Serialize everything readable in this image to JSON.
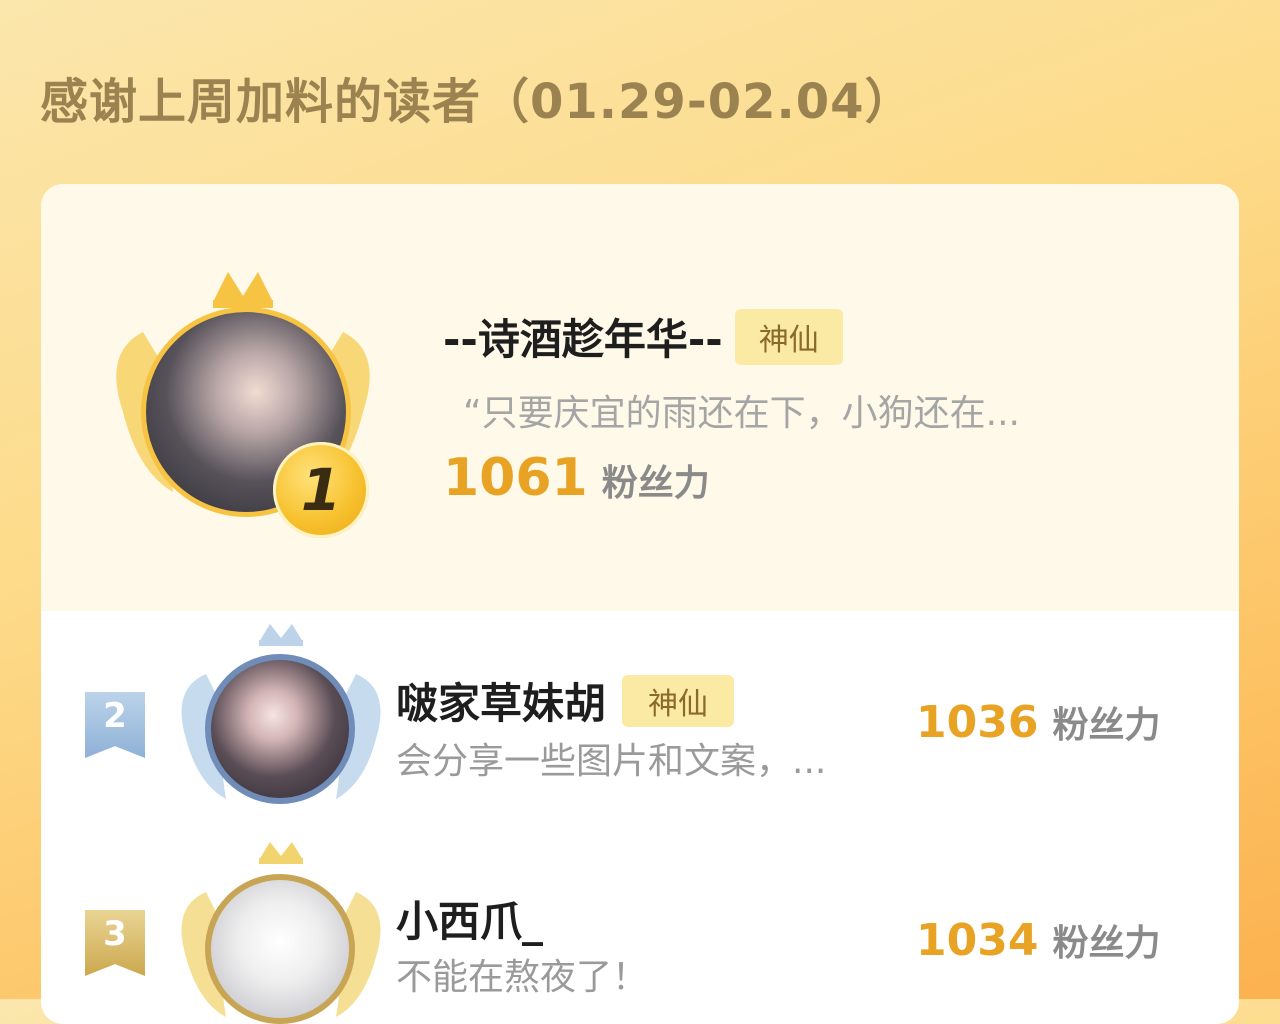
{
  "heading": "感谢上周加料的读者（01.29-02.04）",
  "colors": {
    "accent": "#e8a324",
    "badge_bg": "#fbeaa4",
    "gold": "#f6c343",
    "silver_blue": "#6f8db8",
    "bronze": "#c7a554"
  },
  "ranking": [
    {
      "rank": "1",
      "name": "--诗酒趁年华--",
      "badge": "神仙",
      "description": "“只要庆宜的雨还在下，小狗还在...",
      "points": "1061",
      "points_unit": "粉丝力",
      "icon": "gold-medal-icon"
    },
    {
      "rank": "2",
      "name": "啵家草妹胡",
      "badge": "神仙",
      "description": "会分享一些图片和文案，...",
      "points": "1036",
      "points_unit": "粉丝力",
      "icon": "silver-ribbon-icon"
    },
    {
      "rank": "3",
      "name": "小西爪_",
      "badge": "",
      "description": "不能在熬夜了！",
      "points": "1034",
      "points_unit": "粉丝力",
      "icon": "bronze-ribbon-icon"
    }
  ]
}
